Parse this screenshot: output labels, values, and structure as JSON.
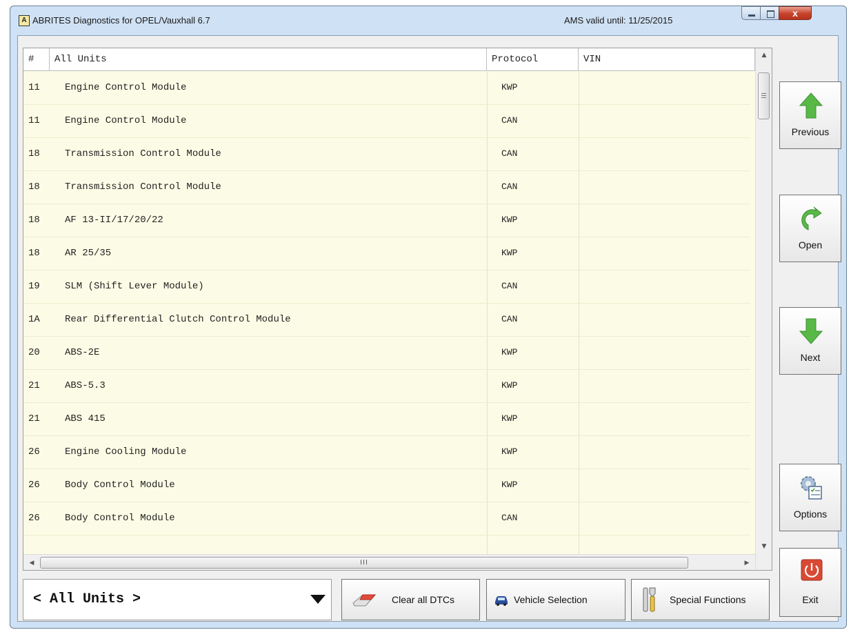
{
  "window": {
    "icon_letter": "A",
    "title": "ABRITES Diagnostics for OPEL/Vauxhall 6.7",
    "ams_valid": "AMS valid until: 11/25/2015",
    "close_glyph": "x"
  },
  "table": {
    "headers": {
      "num": "#",
      "name": "All Units",
      "protocol": "Protocol",
      "vin": "VIN"
    },
    "rows": [
      {
        "num": "11",
        "name": "Engine Control Module",
        "protocol": "KWP",
        "vin": ""
      },
      {
        "num": "11",
        "name": "Engine Control Module",
        "protocol": "CAN",
        "vin": ""
      },
      {
        "num": "18",
        "name": "Transmission Control Module",
        "protocol": "CAN",
        "vin": ""
      },
      {
        "num": "18",
        "name": "Transmission Control Module",
        "protocol": "CAN",
        "vin": ""
      },
      {
        "num": "18",
        "name": "AF 13-II/17/20/22",
        "protocol": "KWP",
        "vin": ""
      },
      {
        "num": "18",
        "name": "AR 25/35",
        "protocol": "KWP",
        "vin": ""
      },
      {
        "num": "19",
        "name": "SLM (Shift Lever Module)",
        "protocol": "CAN",
        "vin": ""
      },
      {
        "num": "1A",
        "name": "Rear Differential Clutch Control Module",
        "protocol": "CAN",
        "vin": ""
      },
      {
        "num": "20",
        "name": "ABS-2E",
        "protocol": "KWP",
        "vin": ""
      },
      {
        "num": "21",
        "name": "ABS-5.3",
        "protocol": "KWP",
        "vin": ""
      },
      {
        "num": "21",
        "name": "ABS 415",
        "protocol": "KWP",
        "vin": ""
      },
      {
        "num": "26",
        "name": "Engine Cooling Module",
        "protocol": "KWP",
        "vin": ""
      },
      {
        "num": "26",
        "name": "Body Control Module",
        "protocol": "KWP",
        "vin": ""
      },
      {
        "num": "26",
        "name": "Body Control Module",
        "protocol": "CAN",
        "vin": ""
      }
    ],
    "hscroll_grip": "III"
  },
  "side_buttons": {
    "previous": "Previous",
    "open": "Open",
    "next": "Next",
    "options": "Options",
    "exit": "Exit"
  },
  "bottom": {
    "unit_filter": "< All Units >",
    "clear_dtcs": "Clear all DTCs",
    "vehicle_selection": "Vehicle Selection",
    "special_functions": "Special Functions"
  },
  "colors": {
    "grid_background": "#fcfce6",
    "arrow_green": "#58b947",
    "exit_red": "#d94a35"
  }
}
